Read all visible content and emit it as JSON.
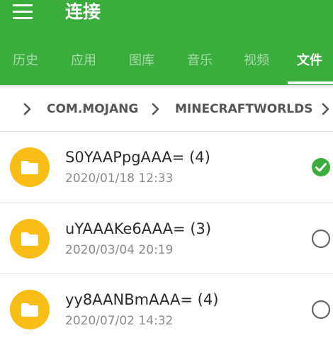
{
  "app": {
    "title": "连接",
    "menu_icon": "hamburger-menu-icon",
    "accent_color": "#3aad3c",
    "folder_color": "#f9be16"
  },
  "tabs": [
    {
      "label": "历史",
      "active": false
    },
    {
      "label": "应用",
      "active": false
    },
    {
      "label": "图库",
      "active": false
    },
    {
      "label": "音乐",
      "active": false
    },
    {
      "label": "视频",
      "active": false
    },
    {
      "label": "文件",
      "active": true
    }
  ],
  "breadcrumb": {
    "items": [
      "COM.MOJANG",
      "MINECRAFTWORLDS"
    ],
    "separator_icon": "chevron-right-icon"
  },
  "files": [
    {
      "name": "S0YAAPpgAAA= (4)",
      "date": "2020/01/18 12:33",
      "selected": true
    },
    {
      "name": "uYAAAKe6AAA= (3)",
      "date": "2020/03/04 20:19",
      "selected": false
    },
    {
      "name": "yy8AANBmAAA= (4)",
      "date": "2020/07/02 14:32",
      "selected": false
    }
  ]
}
